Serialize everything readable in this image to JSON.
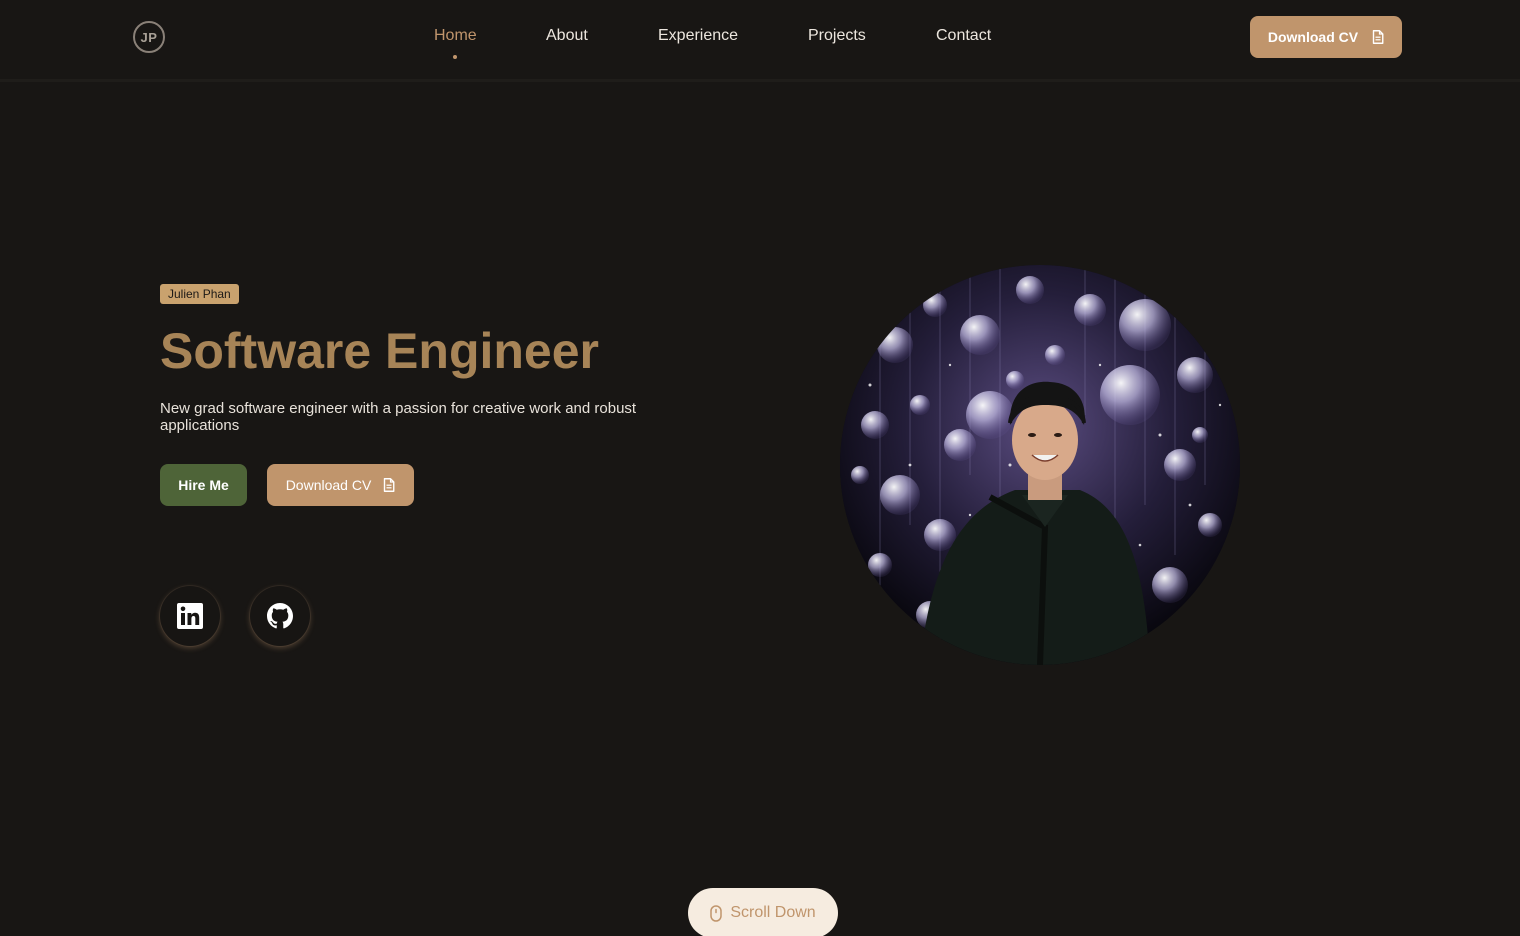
{
  "header": {
    "logo_text": "JP",
    "nav": [
      {
        "label": "Home",
        "active": true
      },
      {
        "label": "About",
        "active": false
      },
      {
        "label": "Experience",
        "active": false
      },
      {
        "label": "Projects",
        "active": false
      },
      {
        "label": "Contact",
        "active": false
      }
    ],
    "cv_button_label": "Download CV",
    "cv_button_icon": "document-icon"
  },
  "hero": {
    "name_badge": "Julien Phan",
    "title": "Software Engineer",
    "description": "New grad software engineer with a passion for creative work and robust applications",
    "hire_button_label": "Hire Me",
    "cv_button_label": "Download CV",
    "cv_button_icon": "document-icon",
    "socials": [
      {
        "name": "linkedin",
        "icon": "linkedin-icon"
      },
      {
        "name": "github",
        "icon": "github-icon"
      }
    ],
    "portrait_icon": "portrait-photo"
  },
  "scroll": {
    "label": "Scroll Down",
    "icon": "mouse-icon"
  },
  "colors": {
    "background": "#181614",
    "accent": "#c0956c",
    "title": "#a78457",
    "hire_button": "#4e6438",
    "badge": "#c9a26e",
    "scroll_pill": "#f6ece0"
  }
}
